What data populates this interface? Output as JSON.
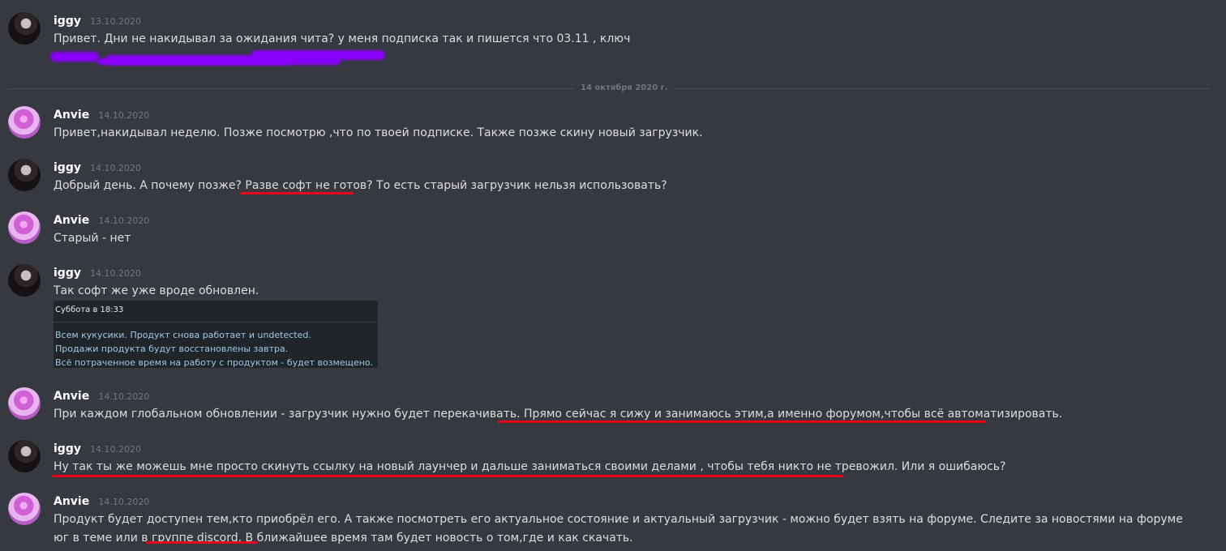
{
  "messages": [
    {
      "author": "iggy",
      "timestamp": "13.10.2020",
      "text": "Привет. Дни не накидывал за ожидания чита? у меня подписка так и пишется что 03.11 , ключ"
    },
    {
      "author": "Anvie",
      "timestamp": "14.10.2020",
      "text": "Привет,накидывал неделю. Позже посмотрю ,что по твоей подписке. Также позже скину новый загрузчик."
    },
    {
      "author": "iggy",
      "timestamp": "14.10.2020",
      "text": "Добрый день. А почему позже? Разве софт не готов? То есть старый загрузчик нельзя использовать?"
    },
    {
      "author": "Anvie",
      "timestamp": "14.10.2020",
      "text": "Старый - нет"
    },
    {
      "author": "iggy",
      "timestamp": "14.10.2020",
      "text": "Так софт же уже вроде обновлен."
    },
    {
      "author": "Anvie",
      "timestamp": "14.10.2020",
      "text": "При каждом глобальном обновлении - загрузчик нужно будет перекачивать. Прямо сейчас я сижу и занимаюсь этим,а именно форумом,чтобы всё автоматизировать."
    },
    {
      "author": "iggy",
      "timestamp": "14.10.2020",
      "text": "Ну так ты же можешь мне просто скинуть ссылку на новый лаунчер и дальше заниматься своими делами , чтобы тебя никто не тревожил. Или я ошибаюсь?"
    },
    {
      "author": "Anvie",
      "timestamp": "14.10.2020",
      "text": "Продукт будет доступен тем,кто приобрёл его. А также посмотреть его актуальное состояние и актуальный загрузчик - можно будет взять на форуме.  Следите за новостями на форуме юг в теме или в группе discord. В ближайшее время там будет новость о том,где и как скачать."
    }
  ],
  "date_divider": "14 октября 2020 г.",
  "embed": {
    "title": "Суббота в 18:33",
    "lines": [
      "Всем кукусики. Продукт снова работает и undetected.",
      "Продажи продукта будут восстановлены завтра.",
      "Всё потраченное время на работу с продуктом - будет возмещено."
    ]
  },
  "colors": {
    "background": "#36393f",
    "underline": "#e8041b",
    "redaction": "#8a00ff"
  }
}
